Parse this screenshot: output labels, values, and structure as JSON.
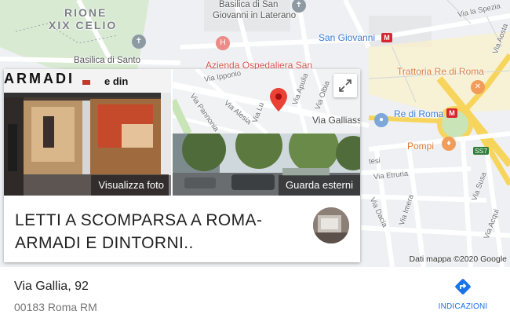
{
  "map": {
    "district_labels": [
      "RIONE",
      "XIX CELIO"
    ],
    "places": {
      "basilica_laterano": [
        "Basilica di San",
        "Giovanni in Laterano"
      ],
      "basilica_santo": "Basilica di Santo",
      "ospedale": "Azienda Ospedaliera San",
      "san_giovanni": "San Giovanni",
      "trattoria": "Trattoria Re di Roma",
      "re_di_roma": "Re di Roma",
      "pompi": "Pompi"
    },
    "streets": {
      "via_la_spezia": "Via la Spezia",
      "via_gallia": "Via Gallia",
      "via_etruria": "Via Etruria",
      "via_dacia": "Via Dacia",
      "via_susa": "Via Susa",
      "via_aosta": "Via Aosta",
      "via_acqui": "Via Acqui",
      "via_imera": "Via Imera",
      "via_tesi": "tesi"
    },
    "route_shield": "SS7",
    "metro_symbol": "M",
    "attribution": "Dati mappa ©2020 Google"
  },
  "card": {
    "store_sign": "ARMADI",
    "store_sign_suffix": "e din",
    "photo_caption": "Visualizza foto",
    "street_view_caption": "Guarda esterni",
    "mini_map_streets": {
      "via_ipponio": "Via Ipponio",
      "via_apulia": "Via Apulia",
      "via_olbia": "Via Olbia",
      "via_alesia": "Via Alesia",
      "via_pannonia": "Via Pannonia",
      "via_gallia": "Via Gallia",
      "via_lusitania": "Via Lu",
      "tail": "ssi"
    },
    "title": "LETTI A SCOMPARSA A ROMA-ARMADI E DINTORNI.."
  },
  "address": {
    "street": "Via Gallia, 92",
    "city": "00183 Roma RM"
  },
  "directions": {
    "label": "INDICAZIONI",
    "icon": "directions-icon"
  },
  "colors": {
    "pin": "#ea4335",
    "link": "#1a73e8",
    "metro": "#d7262f",
    "major_road": "#f7d55c"
  }
}
